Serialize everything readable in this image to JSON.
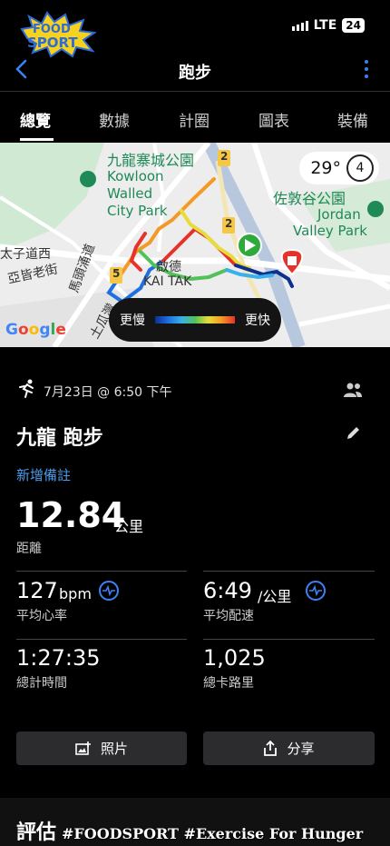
{
  "status_bar": {
    "network": "LTE",
    "battery": "24"
  },
  "watermark_logo": "FOODSPORT",
  "nav": {
    "title": "跑步"
  },
  "tabs": [
    {
      "label": "總覽",
      "active": true
    },
    {
      "label": "數據",
      "active": false
    },
    {
      "label": "計圈",
      "active": false
    },
    {
      "label": "圖表",
      "active": false
    },
    {
      "label": "裝備",
      "active": false
    }
  ],
  "map": {
    "temperature": "29°",
    "lap_count": "4",
    "labels": {
      "park1": "九龍寨城公園",
      "park1_en_1": "Kowloon",
      "park1_en_2": "Walled",
      "park1_en_3": "City Park",
      "park2": "佐敦谷公園",
      "park2_en_1": "Jordan",
      "park2_en_2": "Valley Park",
      "road1": "太子道西",
      "road2": "亞皆老街",
      "road3": "馬頭涌道",
      "district_zh": "啟德",
      "district_en": "KAI TAK",
      "road4": "土瓜灣",
      "route_2a": "2",
      "route_2b": "2",
      "route_5": "5",
      "google": "Google"
    },
    "legend": {
      "slower": "更慢",
      "faster": "更快"
    },
    "colors": {
      "route_slow": "#0d2f8e",
      "route_mid": "#53c15a",
      "route_fast": "#e5322b",
      "start": "#2eaa3a",
      "end": "#e5322b"
    }
  },
  "activity": {
    "datetime": "7月23日 @ 6:50 下午",
    "title": "九龍 跑步",
    "add_note": "新增備註",
    "distance": {
      "value": "12.84",
      "unit": "公里",
      "label": "距離"
    },
    "heart_rate": {
      "value": "127",
      "unit": "bpm",
      "label": "平均心率"
    },
    "pace": {
      "value": "6:49",
      "unit": "/公里",
      "label": "平均配速"
    },
    "time": {
      "value": "1:27:35",
      "label": "總計時間"
    },
    "calories": {
      "value": "1,025",
      "label": "總卡路里"
    }
  },
  "buttons": {
    "photos": "照片",
    "share": "分享"
  },
  "evaluation": {
    "title": "評估"
  },
  "watermark_text": "#FOODSPORT #Exercise For Hunger"
}
